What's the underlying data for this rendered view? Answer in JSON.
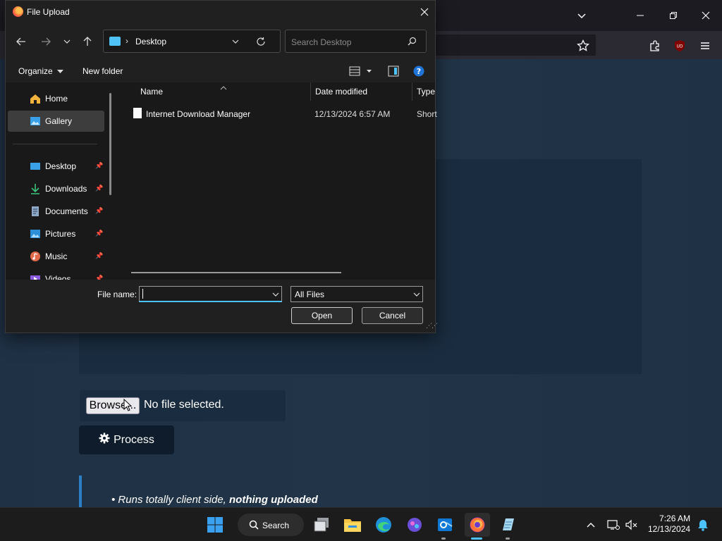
{
  "browser": {
    "page": {
      "browse_button": "Browse...",
      "no_file_text": "No file selected.",
      "process_button": "Process",
      "bullet_text": "Runs totally client side, ",
      "bullet_bold": "nothing uploaded"
    },
    "toolbar_icons": [
      "bookmark-star-icon",
      "extensions-icon",
      "ublock-icon",
      "menu-icon"
    ]
  },
  "dialog": {
    "title": "File Upload",
    "address": {
      "location": "Desktop"
    },
    "search_placeholder": "Search Desktop",
    "commands": {
      "organize": "Organize",
      "new_folder": "New folder"
    },
    "sidebar": [
      {
        "label": "Home",
        "icon": "home-icon",
        "selected": false
      },
      {
        "label": "Gallery",
        "icon": "gallery-icon",
        "selected": true
      },
      {
        "label": "Desktop",
        "icon": "desktop-icon",
        "pinned": true
      },
      {
        "label": "Downloads",
        "icon": "downloads-icon",
        "pinned": true
      },
      {
        "label": "Documents",
        "icon": "documents-icon",
        "pinned": true
      },
      {
        "label": "Pictures",
        "icon": "pictures-icon",
        "pinned": true
      },
      {
        "label": "Music",
        "icon": "music-icon",
        "pinned": true
      },
      {
        "label": "Videos",
        "icon": "videos-icon",
        "pinned": true
      }
    ],
    "columns": {
      "name": "Name",
      "date_modified": "Date modified",
      "type": "Type"
    },
    "files": [
      {
        "name": "Internet Download Manager",
        "date_modified": "12/13/2024 6:57 AM",
        "type": "Short"
      }
    ],
    "file_name_label": "File name:",
    "file_name_value": "",
    "file_type": "All Files",
    "open_button": "Open",
    "cancel_button": "Cancel"
  },
  "taskbar": {
    "search_label": "Search",
    "time": "7:26 AM",
    "date": "12/13/2024"
  },
  "colors": {
    "accent": "#4cc2ff",
    "page_bg": "#23364a",
    "dialog_bg": "#202020",
    "quote_bar": "#2d7fc4"
  }
}
